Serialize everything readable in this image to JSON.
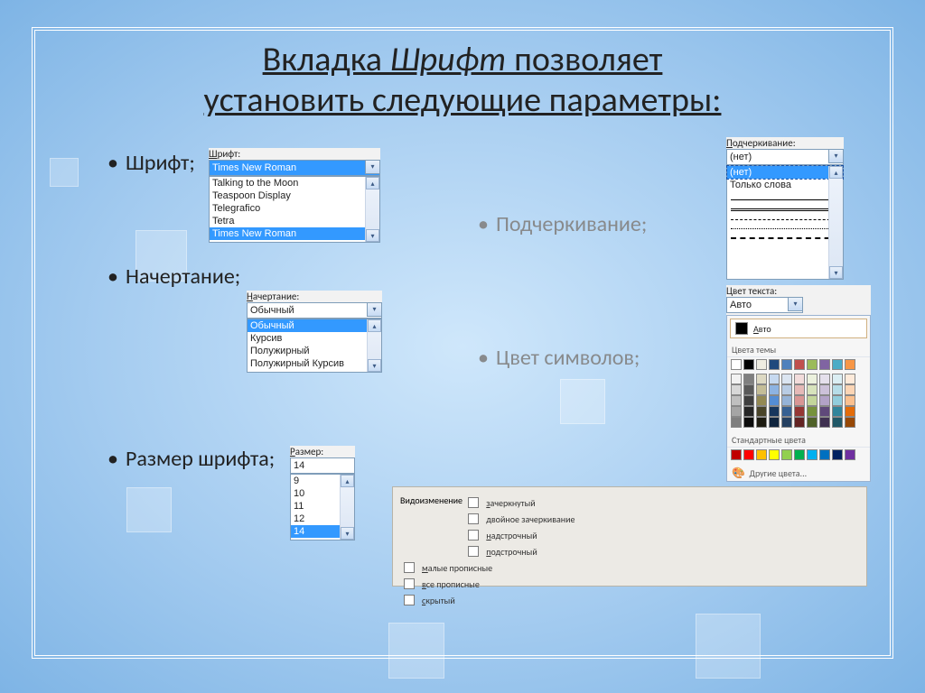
{
  "title_a": "Вкладка ",
  "title_em": "Шрифт",
  "title_b": " позволяет",
  "title_line2": "установить следующие параметры:",
  "bullets": {
    "font": "Шрифт;",
    "style": "Начертание;",
    "size": "Размер шрифта;",
    "underline": "Подчеркивание;",
    "color": "Цвет символов;"
  },
  "font_panel": {
    "label_u": "Ш",
    "label_rest": "рифт:",
    "value": "Times New Roman",
    "options": [
      "Talking to the Moon",
      "Teaspoon Display",
      "Telegrafico",
      "Tetra",
      "Times New Roman"
    ]
  },
  "style_panel": {
    "label_u": "Н",
    "label_rest": "ачертание:",
    "value": "Обычный",
    "options": [
      "Обычный",
      "Курсив",
      "Полужирный",
      "Полужирный Курсив"
    ]
  },
  "size_panel": {
    "label_u": "Р",
    "label_rest": "азмер:",
    "value": "14",
    "options": [
      "9",
      "10",
      "11",
      "12",
      "14"
    ]
  },
  "underline_panel": {
    "label_u": "П",
    "label_rest": "одчеркивание:",
    "value": "(нет)",
    "first_option": "(нет)",
    "second_option": "Только слова"
  },
  "color_panel": {
    "label": "Цвет текста:",
    "value": "Авто",
    "auto_u": "А",
    "auto_rest": "вто",
    "section_theme": "Цвета темы",
    "section_standard": "Стандартные цвета",
    "more_u": "Д",
    "more_rest": "ругие цвета...",
    "theme_row1": [
      "#ffffff",
      "#000000",
      "#eeece1",
      "#1f497d",
      "#4f81bd",
      "#c0504d",
      "#9bbb59",
      "#8064a2",
      "#4bacc6",
      "#f79646"
    ],
    "theme_tints": [
      [
        "#f2f2f2",
        "#7f7f7f",
        "#ddd9c3",
        "#c6d9f0",
        "#dbe5f1",
        "#f2dcdb",
        "#ebf1dd",
        "#e5e0ec",
        "#dbeef3",
        "#fdeada"
      ],
      [
        "#d8d8d8",
        "#595959",
        "#c4bd97",
        "#8db3e2",
        "#b8cce4",
        "#e5b9b7",
        "#d7e3bc",
        "#ccc1d9",
        "#b7dde8",
        "#fbd5b5"
      ],
      [
        "#bfbfbf",
        "#3f3f3f",
        "#938953",
        "#548dd4",
        "#95b3d7",
        "#d99694",
        "#c3d69b",
        "#b2a2c7",
        "#92cddc",
        "#fac08f"
      ],
      [
        "#a5a5a5",
        "#262626",
        "#494429",
        "#17365d",
        "#366092",
        "#953734",
        "#76923c",
        "#5f497a",
        "#31859b",
        "#e36c09"
      ],
      [
        "#7f7f7f",
        "#0c0c0c",
        "#1d1b10",
        "#0f243e",
        "#244061",
        "#632423",
        "#4f6128",
        "#3f3151",
        "#205867",
        "#974806"
      ]
    ],
    "standard": [
      "#c00000",
      "#ff0000",
      "#ffc000",
      "#ffff00",
      "#92d050",
      "#00b050",
      "#00b0f0",
      "#0070c0",
      "#002060",
      "#7030a0"
    ]
  },
  "fx_panel": {
    "legend": "Видоизменение",
    "left": [
      {
        "u": "з",
        "rest": "ачеркнутый"
      },
      {
        "u": "д",
        "rest": "войное зачеркивание"
      },
      {
        "u": "н",
        "rest": "адстрочный"
      },
      {
        "u": "п",
        "rest": "одстрочный"
      }
    ],
    "right": [
      {
        "u": "м",
        "rest": "алые прописные"
      },
      {
        "u": "в",
        "rest": "се прописные"
      },
      {
        "u": "с",
        "rest": "крытый"
      }
    ]
  }
}
